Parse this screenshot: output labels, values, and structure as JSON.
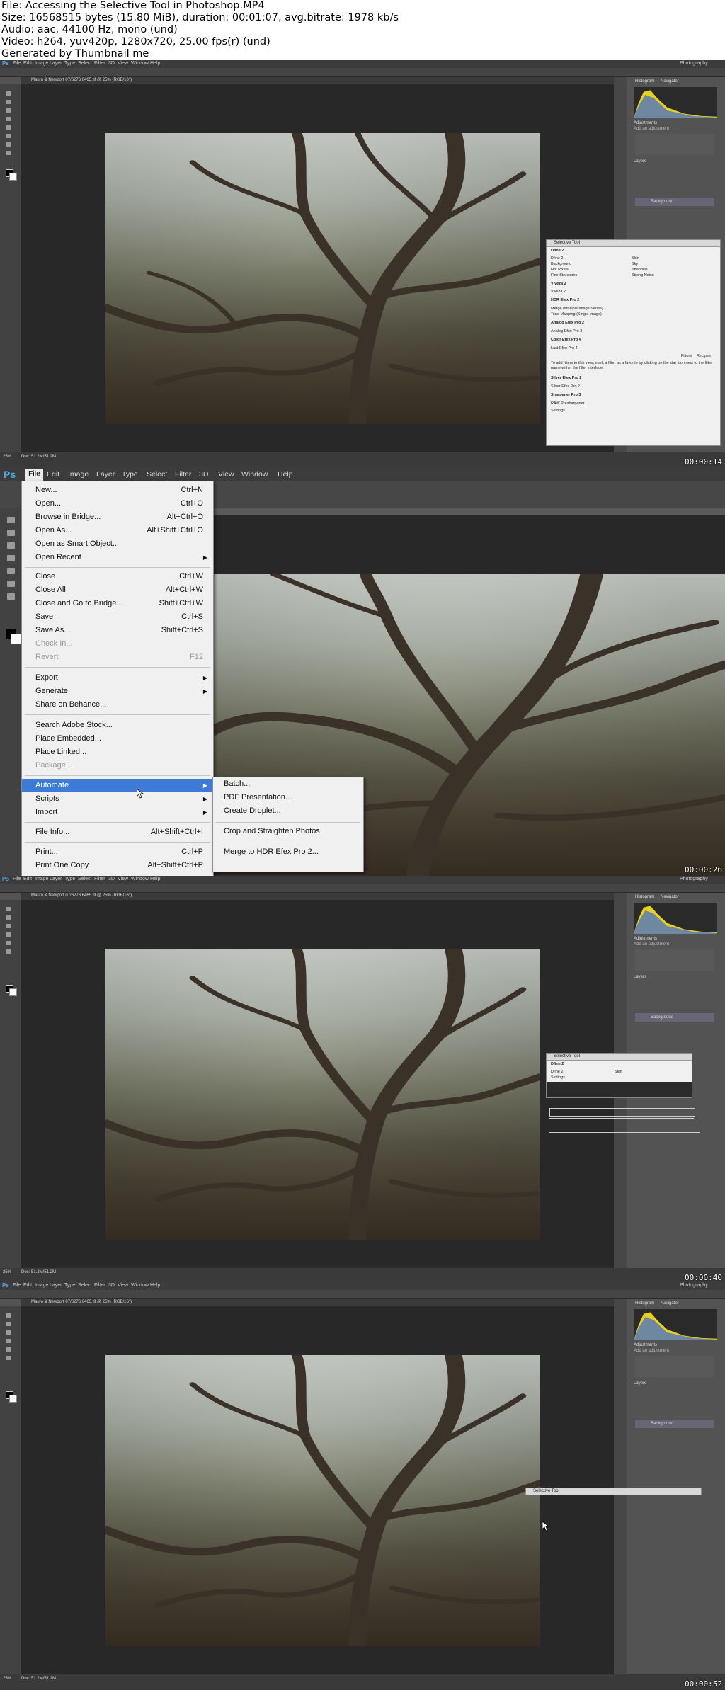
{
  "header": {
    "line1": "File: Accessing the Selective Tool in Photoshop.MP4",
    "line2": "Size: 16568515 bytes (15.80 MiB), duration: 00:01:07, avg.bitrate: 1978 kb/s",
    "line3": "Audio: aac, 44100 Hz, mono (und)",
    "line4": "Video: h264, yuv420p, 1280x720, 25.00 fps(r) (und)",
    "line5": "Generated by Thumbnail me"
  },
  "ps": {
    "logo": "Ps",
    "menus": [
      "File",
      "Edit",
      "Image",
      "Layer",
      "Type",
      "Select",
      "Filter",
      "3D",
      "View",
      "Window",
      "Help"
    ],
    "workspace": "Photography",
    "doc_tab": "Mauro & Newport 07/6276 6465.tif @ 25% (RGB/16*)"
  },
  "frames": [
    {
      "timestamp": "00:00:14"
    },
    {
      "timestamp": "00:00:26"
    },
    {
      "timestamp": "00:00:40"
    },
    {
      "timestamp": "00:00:52"
    }
  ],
  "panels": {
    "histogram_tab": "Histogram",
    "navigator_tab": "Navigator",
    "adjustments": "Adjustments",
    "add_adjustment": "Add an adjustment",
    "layers_tab": "Layers",
    "layer_name": "Background"
  },
  "selective_tool": {
    "title": "Selective Tool",
    "sections": [
      "Dfine 2",
      "Viveza 2",
      "HDR Efex Pro 2",
      "Analog Efex Pro 2",
      "Color Efex Pro 4",
      "Silver Efex Pro 2",
      "Sharpener Pro 3"
    ],
    "dfine_items": [
      {
        "left": "Dfine 2",
        "right": "Skin"
      },
      {
        "left": "Background",
        "right": "Sky"
      },
      {
        "left": "Hot Pixels",
        "right": "Shadows"
      },
      {
        "left": "Fine Structures",
        "right": "Strong Noise"
      }
    ],
    "viveza_item": "Viveza 2",
    "hdr_items": [
      "Merge (Multiple Image Series)",
      "Tone Mapping (Single Image)"
    ],
    "analog_item": "Analog Efex Pro 2",
    "color_item": "Last Efex Pro 4",
    "filters_btn": "Filters",
    "recipes_btn": "Recipes",
    "hint": "To add filters to this view, mark a filter as a favorite by clicking on the star icon next to the filter name within the filter interface.",
    "silver_item": "Silver Efex Pro 2",
    "sharpener_item": "RAW Presharpener",
    "settings": "Settings",
    "frame3_row_left": "Dfine 2",
    "frame3_row_right": "Skin"
  },
  "file_menu": {
    "items": [
      {
        "label": "New...",
        "shortcut": "Ctrl+N"
      },
      {
        "label": "Open...",
        "shortcut": "Ctrl+O"
      },
      {
        "label": "Browse in Bridge...",
        "shortcut": "Alt+Ctrl+O"
      },
      {
        "label": "Open As...",
        "shortcut": "Alt+Shift+Ctrl+O"
      },
      {
        "label": "Open as Smart Object...",
        "shortcut": ""
      },
      {
        "label": "Open Recent",
        "shortcut": ""
      },
      {
        "label": "Close",
        "shortcut": "Ctrl+W"
      },
      {
        "label": "Close All",
        "shortcut": "Alt+Ctrl+W"
      },
      {
        "label": "Close and Go to Bridge...",
        "shortcut": "Shift+Ctrl+W"
      },
      {
        "label": "Save",
        "shortcut": "Ctrl+S"
      },
      {
        "label": "Save As...",
        "shortcut": "Shift+Ctrl+S"
      },
      {
        "label": "Check In...",
        "shortcut": ""
      },
      {
        "label": "Revert",
        "shortcut": "F12"
      },
      {
        "label": "Export",
        "shortcut": ""
      },
      {
        "label": "Generate",
        "shortcut": ""
      },
      {
        "label": "Share on Behance...",
        "shortcut": ""
      },
      {
        "label": "Search Adobe Stock...",
        "shortcut": ""
      },
      {
        "label": "Place Embedded...",
        "shortcut": ""
      },
      {
        "label": "Place Linked...",
        "shortcut": ""
      },
      {
        "label": "Package...",
        "shortcut": ""
      },
      {
        "label": "Automate",
        "shortcut": ""
      },
      {
        "label": "Scripts",
        "shortcut": ""
      },
      {
        "label": "Import",
        "shortcut": ""
      },
      {
        "label": "File Info...",
        "shortcut": "Alt+Shift+Ctrl+I"
      },
      {
        "label": "Print...",
        "shortcut": "Ctrl+P"
      },
      {
        "label": "Print One Copy",
        "shortcut": "Alt+Shift+Ctrl+P"
      }
    ]
  },
  "automate_submenu": {
    "items": [
      "Batch...",
      "PDF Presentation...",
      "Create Droplet...",
      "Crop and Straighten Photos",
      "Merge to HDR Efex Pro 2..."
    ]
  },
  "zoom_status": "25%",
  "doc_status": "Doc: 51.2M/51.2M"
}
